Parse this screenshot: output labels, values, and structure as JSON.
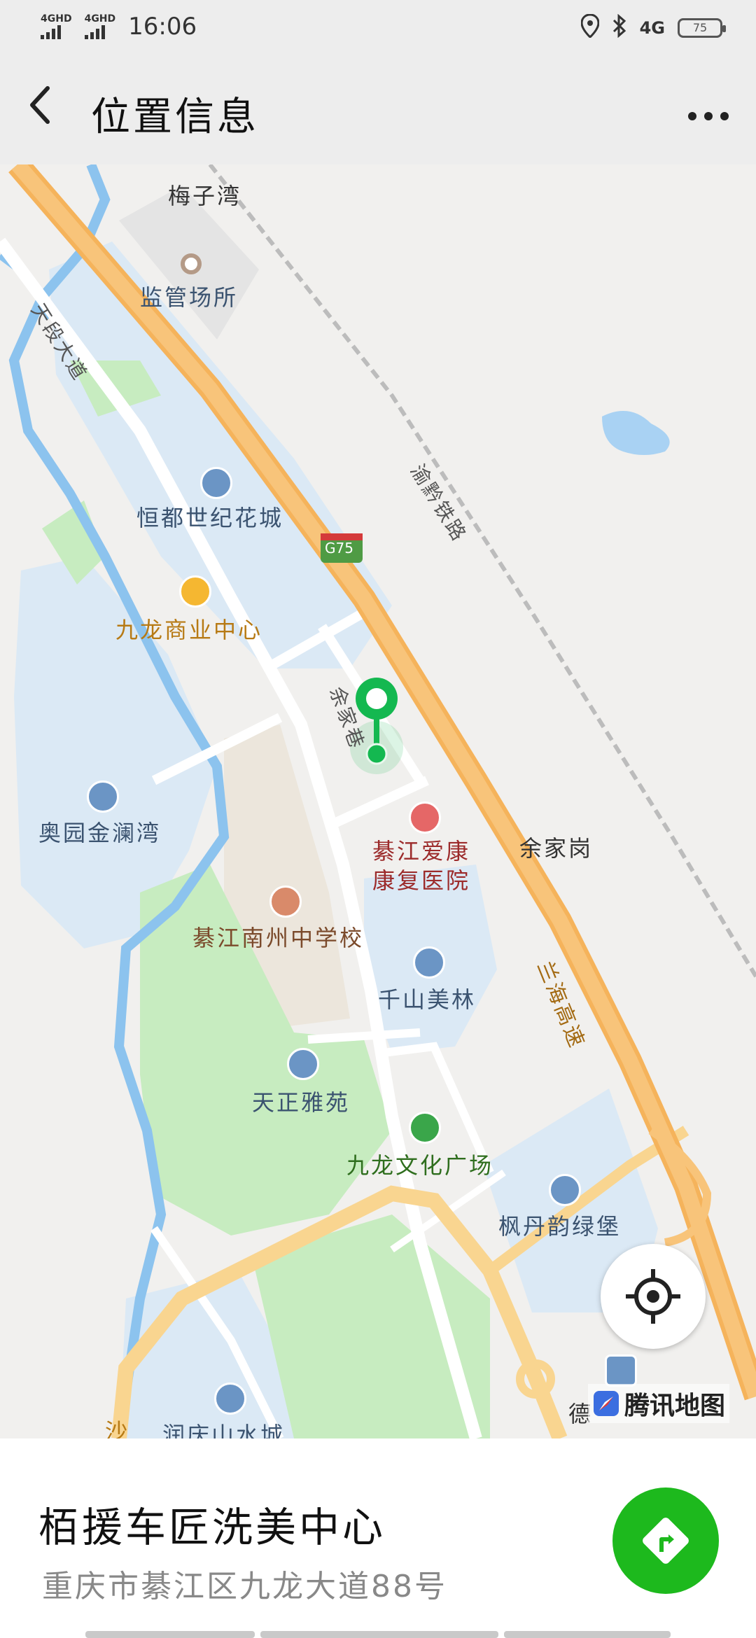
{
  "status_bar": {
    "sim1": "4GHD",
    "sim2": "4GHD",
    "time": "16:06",
    "network": "4G",
    "battery": "75"
  },
  "header": {
    "back_icon": "chevron-left-icon",
    "title": "位置信息",
    "more_icon": "more-dots-icon"
  },
  "map": {
    "labels": {
      "meizi_wan": "梅子湾",
      "jianguan": "监管场所",
      "tianji_dadao": "天段大道",
      "hengdu": "恒都世纪花城",
      "yuqian_tielu": "渝黔铁路",
      "g75": "G75",
      "jiulong_shangye": "九龙商业中心",
      "yujia_jie": "余家巷",
      "aoyuan": "奥园金澜湾",
      "qijiang_hospital": "綦江爱康康复医院",
      "yujiagang": "余家岗",
      "nanzhou_school": "綦江南州中学校",
      "qianshan": "千山美林",
      "lanhai": "兰海高速",
      "tianzheng": "天正雅苑",
      "jiulong_square": "九龙文化广场",
      "fengdan": "枫丹韵绿堡",
      "runqing": "润庆山水城",
      "sha": "沙",
      "de": "德"
    },
    "logo_text": "腾讯地图",
    "locate_icon": "locate-crosshair-icon",
    "pin_icon": "location-pin-icon",
    "colors": {
      "highway": "#f5b35b",
      "green_zone": "#c7ecc0",
      "blue_zone": "#dbe9f5",
      "river": "#8cc3ee",
      "pin": "#14b850"
    }
  },
  "place": {
    "name": "栢援车匠洗美中心",
    "address": "重庆市綦江区九龙大道88号",
    "nav_icon": "navigation-arrow-icon"
  }
}
